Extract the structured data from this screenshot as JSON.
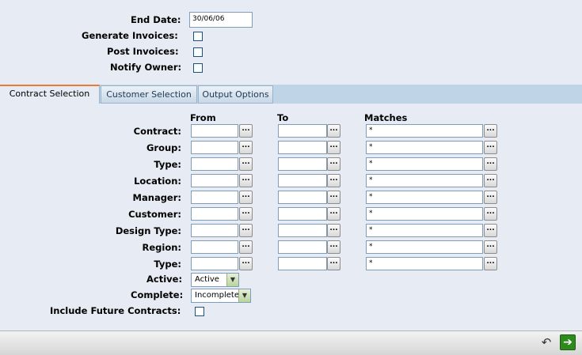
{
  "top_form": {
    "end_date_label": "End Date:",
    "end_date_value": "30/06/06",
    "generate_invoices_label": "Generate Invoices:",
    "post_invoices_label": "Post Invoices:",
    "notify_owner_label": "Notify Owner:"
  },
  "tabs": [
    {
      "label": "Contract Selection",
      "active": true
    },
    {
      "label": "Customer Selection",
      "active": false
    },
    {
      "label": "Output Options",
      "active": false
    }
  ],
  "columns": {
    "from": "From",
    "to": "To",
    "matches": "Matches"
  },
  "lookup_button_label": "...",
  "rows": [
    {
      "label": "Contract:",
      "from": "",
      "to": "",
      "matches": "*"
    },
    {
      "label": "Group:",
      "from": "",
      "to": "",
      "matches": "*"
    },
    {
      "label": "Type:",
      "from": "",
      "to": "",
      "matches": "*"
    },
    {
      "label": "Location:",
      "from": "",
      "to": "",
      "matches": "*"
    },
    {
      "label": "Manager:",
      "from": "",
      "to": "",
      "matches": "*"
    },
    {
      "label": "Customer:",
      "from": "",
      "to": "",
      "matches": "*"
    },
    {
      "label": "Design Type:",
      "from": "",
      "to": "",
      "matches": "*"
    },
    {
      "label": "Region:",
      "from": "",
      "to": "",
      "matches": "*"
    },
    {
      "label": "Type:",
      "from": "",
      "to": "",
      "matches": "*"
    }
  ],
  "active": {
    "label": "Active:",
    "value": "Active"
  },
  "complete": {
    "label": "Complete:",
    "value": "Incomplete"
  },
  "include_future": {
    "label": "Include Future Contracts:"
  },
  "footer": {
    "back_icon": "undo-arrow-icon",
    "next_icon": "right-arrow-icon",
    "back_glyph": "↶",
    "next_glyph": "➔"
  }
}
